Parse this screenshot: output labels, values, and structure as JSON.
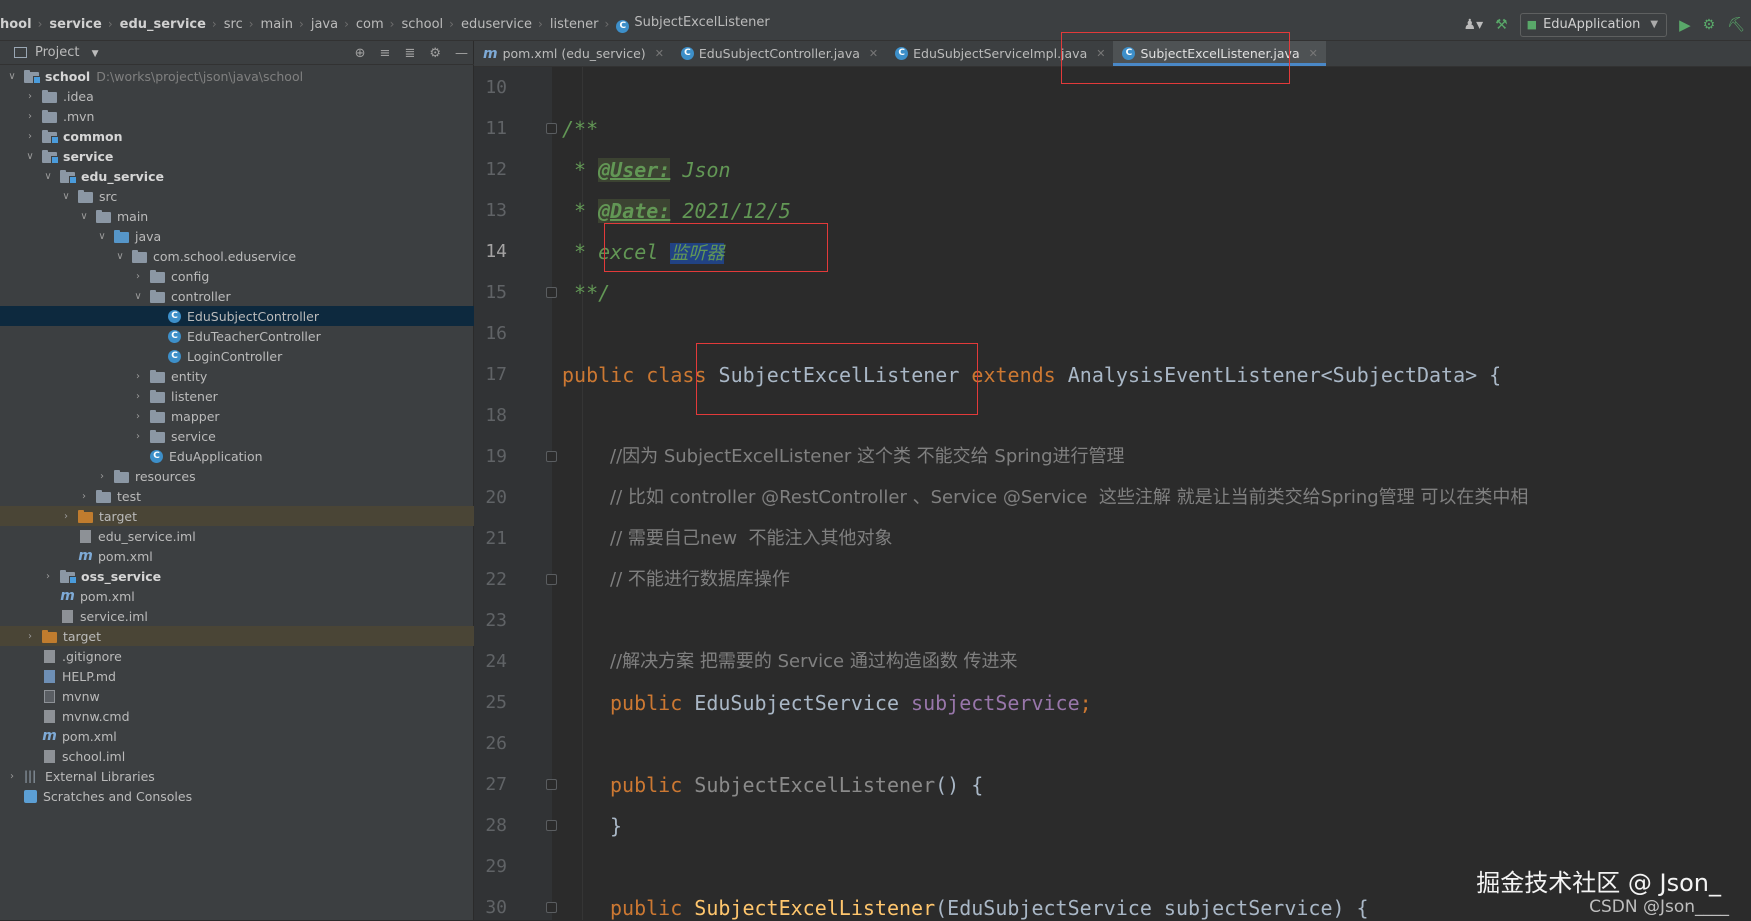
{
  "breadcrumb": [
    "hool",
    "service",
    "edu_service",
    "src",
    "main",
    "java",
    "com",
    "school",
    "eduservice",
    "listener",
    "SubjectExcelListener"
  ],
  "run_config": "EduApplication",
  "project_panel": {
    "title": "Project",
    "tree": {
      "root_name": "school",
      "root_path": "D:\\works\\project\\json\\java\\school",
      "idea": ".idea",
      "mvn": ".mvn",
      "common": "common",
      "service": "service",
      "edu_service": "edu_service",
      "src": "src",
      "main": "main",
      "java": "java",
      "package": "com.school.eduservice",
      "config": "config",
      "controller": "controller",
      "c1": "EduSubjectController",
      "c2": "EduTeacherController",
      "c3": "LoginController",
      "entity": "entity",
      "listener": "listener",
      "mapper": "mapper",
      "service_pkg": "service",
      "app": "EduApplication",
      "resources": "resources",
      "test": "test",
      "target1": "target",
      "edu_iml": "edu_service.iml",
      "edu_pom": "pom.xml",
      "oss": "oss_service",
      "svc_pom": "pom.xml",
      "svc_iml": "service.iml",
      "target2": "target",
      "gitignore": ".gitignore",
      "help": "HELP.md",
      "mvnw": "mvnw",
      "mvnwcmd": "mvnw.cmd",
      "root_pom": "pom.xml",
      "school_iml": "school.iml",
      "ext": "External Libraries",
      "scratch": "Scratches and Consoles"
    }
  },
  "tabs": [
    {
      "label": "pom.xml (edu_service)"
    },
    {
      "label": "EduSubjectController.java"
    },
    {
      "label": "EduSubjectServiceImpl.java"
    },
    {
      "label": "SubjectExcelListener.java"
    }
  ],
  "editor": {
    "line_numbers": [
      "10",
      "11",
      "12",
      "13",
      "14",
      "15",
      "16",
      "17",
      "18",
      "19",
      "20",
      "21",
      "22",
      "23",
      "24",
      "25",
      "26",
      "27",
      "28",
      "29",
      "30"
    ],
    "code": {
      "l11": "/**",
      "l12_star": " * ",
      "l12_tag": "@User:",
      "l12_val": " Json",
      "l13_star": " * ",
      "l13_tag": "@Date:",
      "l13_val": " 2021/12/5",
      "l14_a": " * excel ",
      "l14_b": "监听器",
      "l15": " **/",
      "l17_kw": "public class ",
      "l17_name": "SubjectExcelListener ",
      "l17_ext": "extends ",
      "l17_rest": "AnalysisEventListener<SubjectData> {",
      "l19": "//因为 SubjectExcelListener 这个类 不能交给 Spring进行管理",
      "l20": "// 比如 controller @RestController 、Service @Service  这些注解 就是让当前类交给Spring管理 可以在类中相",
      "l21": "// 需要自己new  不能注入其他对象",
      "l22": "// 不能进行数据库操作",
      "l24": "//解决方案 把需要的 Service 通过构造函数 传进来",
      "l25_kw": "public ",
      "l25_type": "EduSubjectService ",
      "l25_field": "subjectService",
      "l25_semi": ";",
      "l27_kw": "public ",
      "l27_name": "SubjectExcelListener",
      "l27_rest": "() {",
      "l28": "}",
      "l30_kw": "public ",
      "l30_name": "SubjectExcelListener",
      "l30_rest": "(EduSubjectService subjectService) {"
    }
  },
  "watermark": {
    "line1": "掘金技术社区 @ Json_",
    "line2": "CSDN @Json____"
  }
}
